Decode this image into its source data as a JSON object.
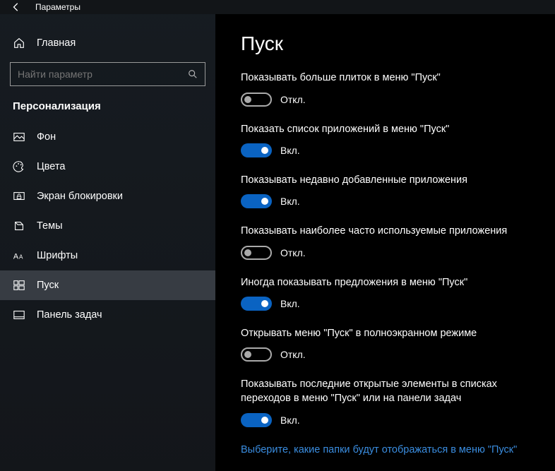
{
  "titlebar": {
    "title": "Параметры"
  },
  "sidebar": {
    "home_label": "Главная",
    "search_placeholder": "Найти параметр",
    "section_title": "Персонализация",
    "items": [
      {
        "label": "Фон"
      },
      {
        "label": "Цвета"
      },
      {
        "label": "Экран блокировки"
      },
      {
        "label": "Темы"
      },
      {
        "label": "Шрифты"
      },
      {
        "label": "Пуск"
      },
      {
        "label": "Панель задач"
      }
    ]
  },
  "main": {
    "heading": "Пуск",
    "settings": [
      {
        "label": "Показывать больше плиток в меню \"Пуск\"",
        "state": "off",
        "state_label": "Откл."
      },
      {
        "label": "Показать список приложений в меню \"Пуск\"",
        "state": "on",
        "state_label": "Вкл."
      },
      {
        "label": "Показывать недавно добавленные приложения",
        "state": "on",
        "state_label": "Вкл."
      },
      {
        "label": "Показывать наиболее часто используемые приложения",
        "state": "off",
        "state_label": "Откл."
      },
      {
        "label": "Иногда показывать предложения в меню \"Пуск\"",
        "state": "on",
        "state_label": "Вкл."
      },
      {
        "label": "Открывать меню \"Пуск\" в полноэкранном режиме",
        "state": "off",
        "state_label": "Откл."
      },
      {
        "label": "Показывать последние открытые элементы в списках переходов в меню \"Пуск\" или на панели задач",
        "state": "on",
        "state_label": "Вкл."
      }
    ],
    "link": "Выберите, какие папки будут отображаться в меню \"Пуск\""
  }
}
